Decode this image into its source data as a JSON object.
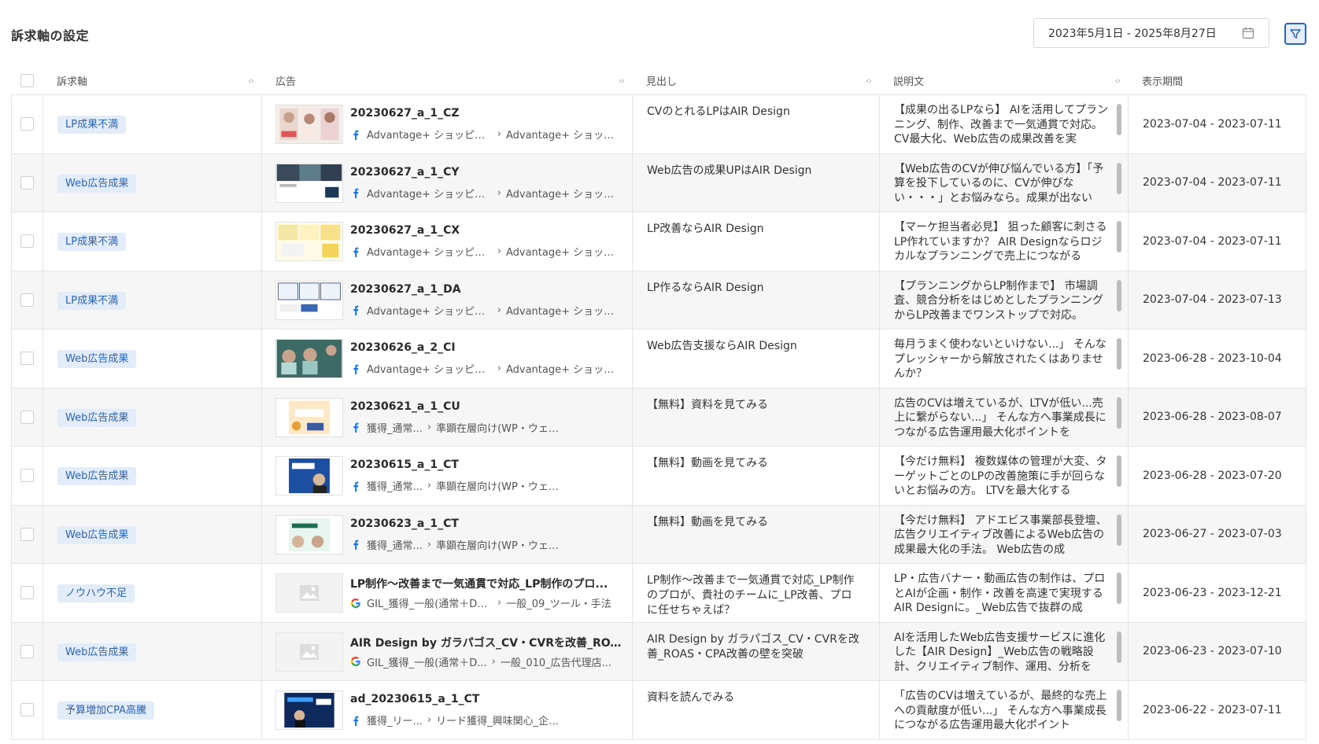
{
  "page": {
    "title": "訴求軸の設定"
  },
  "date_range": {
    "value": "2023年5月1日 - 2025年8月27日"
  },
  "columns": {
    "axis": "訴求軸",
    "ad": "広告",
    "headline": "見出し",
    "description": "説明文",
    "period": "表示期間"
  },
  "rows": [
    {
      "axis": "LP成果不満",
      "ad_name": "20230627_a_1_CZ",
      "platform": "facebook",
      "campaign": "Advantage+ ショッピン...",
      "adset": "Advantage+ ショッピ...",
      "headline": "CVのとれるLPはAIR Design",
      "description": "【成果の出るLPなら】 AIを活用してプランニング、制作、改善まで一気通貫で対応。CV最大化、Web広告の成果改善を実",
      "period": "2023-07-04 - 2023-07-11"
    },
    {
      "axis": "Web広告成果",
      "ad_name": "20230627_a_1_CY",
      "platform": "facebook",
      "campaign": "Advantage+ ショッピン...",
      "adset": "Advantage+ ショッピ...",
      "headline": "Web広告の成果UPはAIR Design",
      "description": "【Web広告のCVが伸び悩んでいる方】「予算を投下しているのに、CVが伸びない・・・」とお悩みなら。成果が出ない",
      "period": "2023-07-04 - 2023-07-11"
    },
    {
      "axis": "LP成果不満",
      "ad_name": "20230627_a_1_CX",
      "platform": "facebook",
      "campaign": "Advantage+ ショッピン...",
      "adset": "Advantage+ ショッピ...",
      "headline": "LP改善ならAIR Design",
      "description": "【マーケ担当者必見】 狙った顧客に刺さるLP作れていますか？ AIR Designならロジカルなプランニングで売上につながる",
      "period": "2023-07-04 - 2023-07-11"
    },
    {
      "axis": "LP成果不満",
      "ad_name": "20230627_a_1_DA",
      "platform": "facebook",
      "campaign": "Advantage+ ショッピン...",
      "adset": "Advantage+ ショッピ...",
      "headline": "LP作るならAIR Design",
      "description": "【プランニングからLP制作まで】 市場調査、競合分析をはじめとしたプランニングからLP改善までワンストップで対応。",
      "period": "2023-07-04 - 2023-07-13"
    },
    {
      "axis": "Web広告成果",
      "ad_name": "20230626_a_2_CI",
      "platform": "facebook",
      "campaign": "Advantage+ ショッピン...",
      "adset": "Advantage+ ショッピ...",
      "headline": "Web広告支援ならAIR Design",
      "description": "毎月うまく使わないといけない...」 そんなプレッシャーから解放されたくはありませんか？",
      "period": "2023-06-28 - 2023-10-04"
    },
    {
      "axis": "Web広告成果",
      "ad_name": "20230621_a_1_CU",
      "platform": "facebook",
      "campaign": "獲得_通常...",
      "adset": "準顕在層向け(WP・ウェビナーア...",
      "headline": "【無料】資料を見てみる",
      "description": "広告のCVは増えているが、LTVが低い...売上に繋がらない...」 そんな方へ事業成長につながる広告運用最大化ポイントを",
      "period": "2023-06-28 - 2023-08-07"
    },
    {
      "axis": "Web広告成果",
      "ad_name": "20230615_a_1_CT",
      "platform": "facebook",
      "campaign": "獲得_通常...",
      "adset": "準顕在層向け(WP・ウェビナーア...",
      "headline": "【無料】動画を見てみる",
      "description": "【今だけ無料】 複数媒体の管理が大変、ターゲットごとのLPの改善施策に手が回らないとお悩みの方。 LTVを最大化する",
      "period": "2023-06-28 - 2023-07-20"
    },
    {
      "axis": "Web広告成果",
      "ad_name": "20230623_a_1_CT",
      "platform": "facebook",
      "campaign": "獲得_通常...",
      "adset": "準顕在層向け(WP・ウェビナーア...",
      "headline": "【無料】動画を見てみる",
      "description": "【今だけ無料】 アドエビス事業部長登壇、広告クリエイティブ改善によるWeb広告の成果最大化の手法。 Web広告の成",
      "period": "2023-06-27 - 2023-07-03"
    },
    {
      "axis": "ノウハウ不足",
      "ad_name": "LP制作〜改善まで一気通貫で対応_LP制作のプロ...",
      "platform": "google",
      "campaign": "GIL_獲得_一般(通常＋DSA)",
      "adset": "一般_09_ツール・手法",
      "headline": "LP制作〜改善まで一気通貫で対応_LP制作のプロが、貴社のチームに_LP改善、プロに任せちゃえば？",
      "description": "LP・広告バナー・動画広告の制作は、プロとAIが企画・制作・改善を高速で実現するAIR Designに。_Web広告で抜群の成",
      "period": "2023-06-23 - 2023-12-21"
    },
    {
      "axis": "Web広告成果",
      "ad_name": "AIR Design by ガラパゴス_CV・CVRを改善_ROA...",
      "platform": "google",
      "campaign": "GIL_獲得_一般(通常＋D...",
      "adset": "一般_010_広告代理店...",
      "headline": "AIR Design by ガラパゴス_CV・CVRを改善_ROAS・CPA改善の壁を突破",
      "description": "AIを活用したWeb広告支援サービスに進化した【AIR Design】_Web広告の戦略設計、クリエイティブ制作、運用、分析を",
      "period": "2023-06-23 - 2023-07-10"
    },
    {
      "axis": "予算増加CPA高騰",
      "ad_name": "ad_20230615_a_1_CT",
      "platform": "facebook",
      "campaign": "獲得_リー...",
      "adset": "リード獲得_興味関心_企業所属×広...",
      "headline": "資料を読んでみる",
      "description": "「広告のCVは増えているが、最終的な売上への貢献度が低い...」 そんな方へ事業成長につながる広告運用最大化ポイント",
      "period": "2023-06-22 - 2023-07-11"
    }
  ],
  "colors": {
    "accent": "#2d64b8",
    "tag_bg": "#e3ecf9",
    "row_alt": "#f6f6f6",
    "border": "#e4e4e4"
  }
}
